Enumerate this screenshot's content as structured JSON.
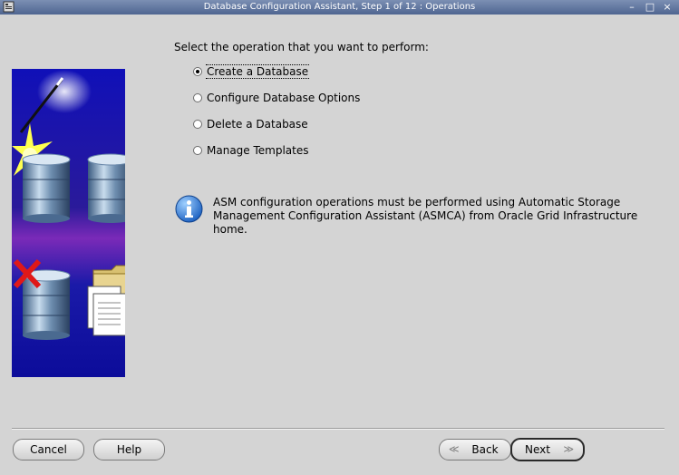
{
  "window": {
    "title": "Database Configuration Assistant, Step 1 of 12 : Operations",
    "controls": {
      "minimize": "–",
      "maximize": "□",
      "close": "×"
    }
  },
  "main": {
    "prompt": "Select the operation that you want to perform:",
    "operations": [
      {
        "label": "Create a Database",
        "selected": true
      },
      {
        "label": "Configure Database Options",
        "selected": false
      },
      {
        "label": "Delete a Database",
        "selected": false
      },
      {
        "label": "Manage Templates",
        "selected": false
      }
    ],
    "info": {
      "icon": "info-icon",
      "line1": "ASM configuration operations must be performed using Automatic Storage",
      "line2": "Management Configuration Assistant (ASMCA) from Oracle Grid Infrastructure home."
    }
  },
  "buttons": {
    "cancel": "Cancel",
    "help": "Help",
    "back": "Back",
    "next": "Next",
    "back_arrow": "≪",
    "next_arrow": "≫"
  },
  "colors": {
    "titlebar": "#5a6f9a",
    "background": "#d4d4d4",
    "art_background": "#1a1aa8"
  }
}
